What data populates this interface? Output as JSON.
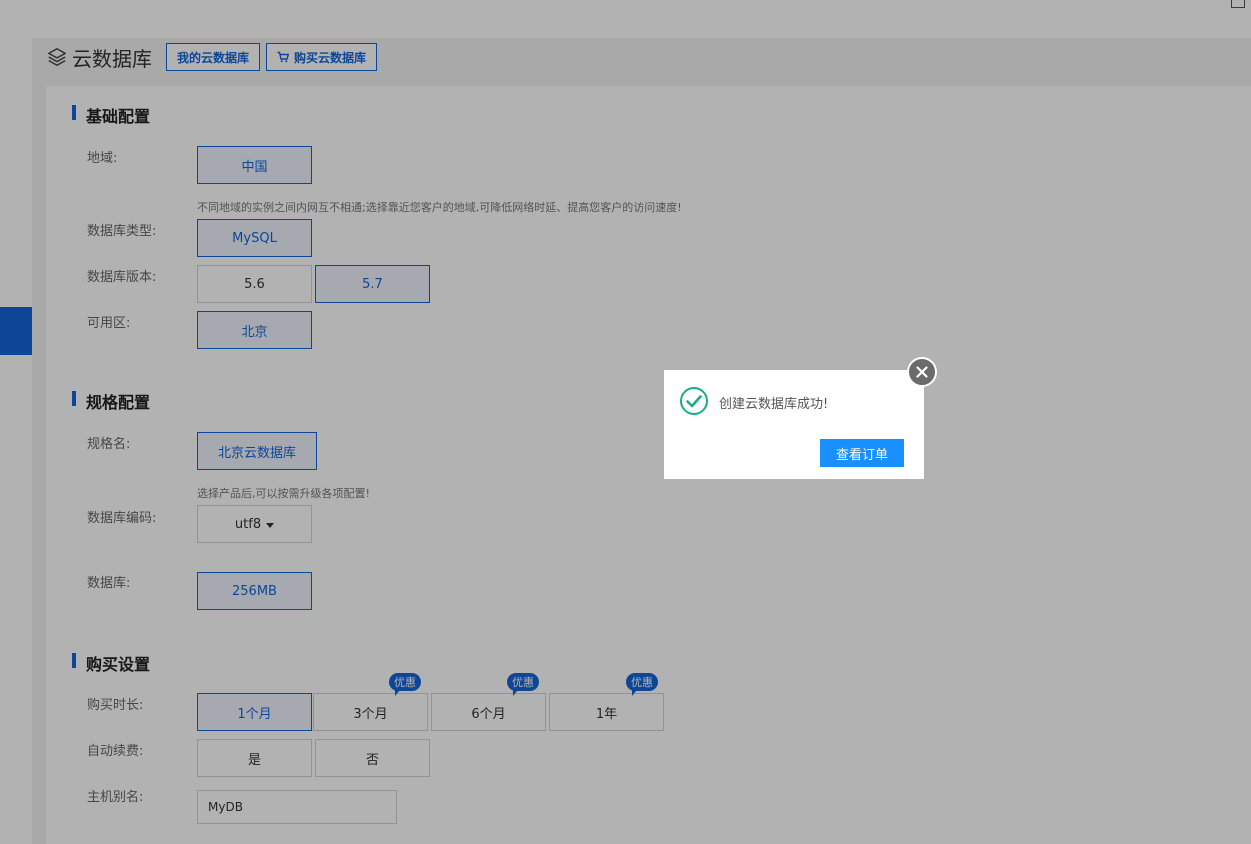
{
  "header": {
    "title": "云数据库",
    "my_db_label": "我的云数据库",
    "buy_db_label": "购买云数据库",
    "db_icon": "layers-icon",
    "cart_icon": "cart-icon"
  },
  "basic": {
    "title": "基础配置",
    "region": {
      "label": "地域:",
      "options": [
        "中国"
      ],
      "selected": "中国",
      "hint": "不同地域的实例之间内网互不相通;选择靠近您客户的地域,可降低网络时延、提高您客户的访问速度!"
    },
    "db_type": {
      "label": "数据库类型:",
      "options": [
        "MySQL"
      ],
      "selected": "MySQL"
    },
    "db_version": {
      "label": "数据库版本:",
      "options": [
        "5.6",
        "5.7"
      ],
      "selected": "5.7"
    },
    "zone": {
      "label": "可用区:",
      "options": [
        "北京"
      ],
      "selected": "北京"
    }
  },
  "spec": {
    "title": "规格配置",
    "spec_name": {
      "label": "规格名:",
      "options": [
        "北京云数据库"
      ],
      "selected": "北京云数据库",
      "hint": "选择产品后,可以按需升级各项配置!"
    },
    "encoding": {
      "label": "数据库编码:",
      "value": "utf8"
    },
    "storage": {
      "label": "数据库:",
      "options": [
        "256MB"
      ],
      "selected": "256MB"
    }
  },
  "purchase": {
    "title": "购买设置",
    "duration": {
      "label": "购买时长:",
      "options": [
        "1个月",
        "3个月",
        "6个月",
        "1年"
      ],
      "selected": "1个月",
      "badge": "优惠"
    },
    "auto_renew": {
      "label": "自动续费:",
      "options": [
        "是",
        "否"
      ]
    },
    "alias": {
      "label": "主机别名:",
      "value": "MyDB"
    }
  },
  "modal": {
    "message": "创建云数据库成功!",
    "button": "查看订单",
    "check_icon": "check-circle-icon",
    "close_icon": "close-icon"
  },
  "colors": {
    "accent": "#1565d8",
    "modal_button": "#1890ff",
    "success": "#1aad85"
  }
}
